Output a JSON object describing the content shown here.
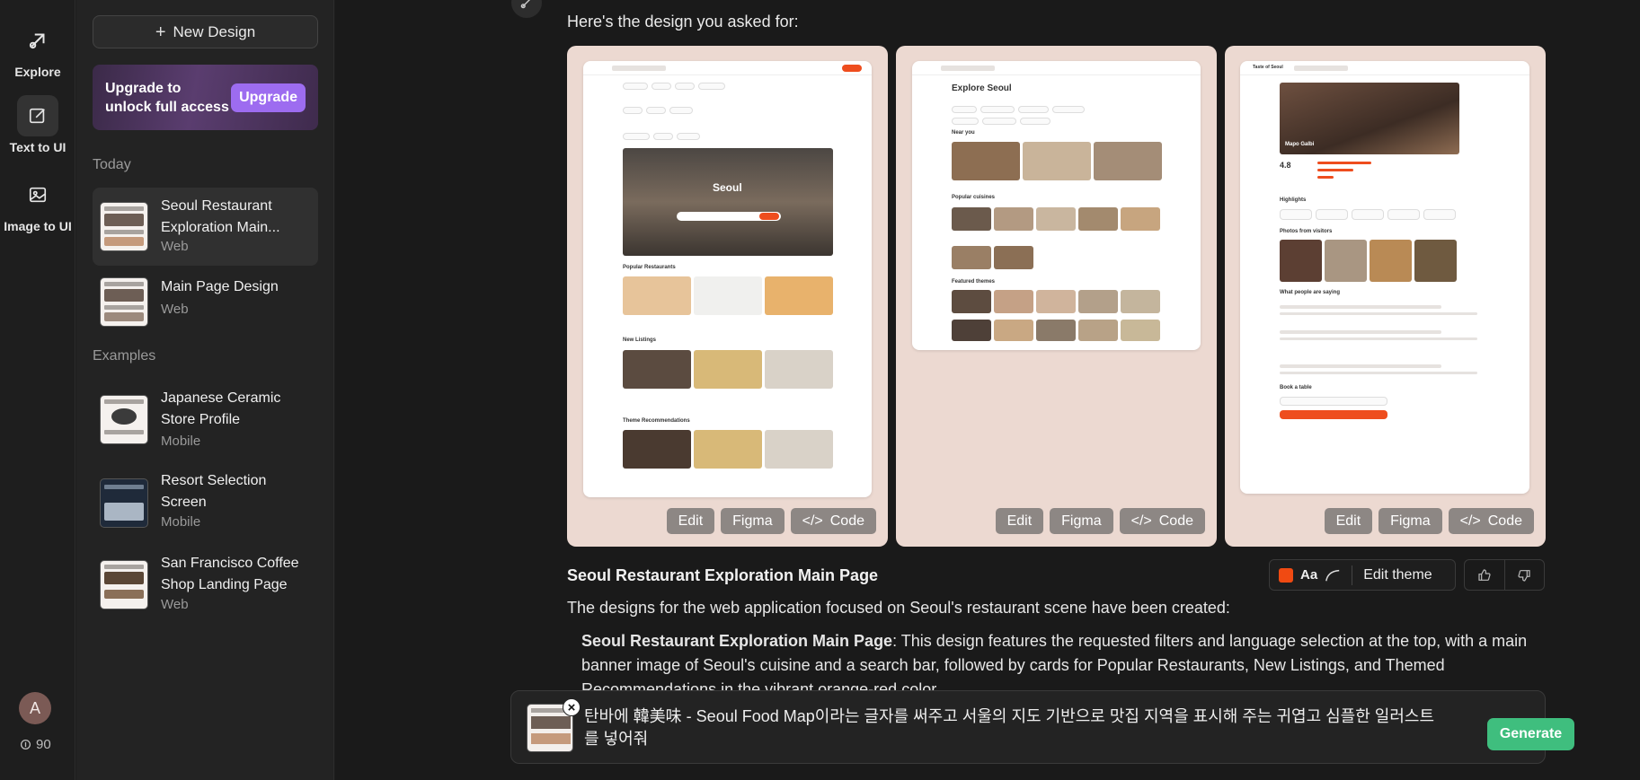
{
  "rail": {
    "explore": "Explore",
    "text_to_ui": "Text to UI",
    "image_to_ui": "Image to UI",
    "avatar_initial": "A",
    "credits": "90"
  },
  "sidebar": {
    "new_design": "New Design",
    "upgrade_text": "Upgrade to unlock full access",
    "upgrade_button": "Upgrade",
    "today_label": "Today",
    "examples_label": "Examples",
    "today": [
      {
        "title": "Seoul Restaurant Exploration Main...",
        "type": "Web"
      },
      {
        "title": "Main Page Design",
        "type": "Web"
      }
    ],
    "examples": [
      {
        "title": "Japanese Ceramic Store Profile",
        "type": "Mobile"
      },
      {
        "title": "Resort Selection Screen",
        "type": "Mobile"
      },
      {
        "title": "San Francisco Coffee Shop Landing Page",
        "type": "Web"
      }
    ]
  },
  "main": {
    "intro": "Here's the design you asked for:",
    "buttons": {
      "edit": "Edit",
      "figma": "Figma",
      "code": "Code"
    },
    "preview1": {
      "hero": "Seoul",
      "popular": "Popular Restaurants",
      "new": "New Listings",
      "theme_rec": "Theme Recommendations"
    },
    "preview2": {
      "title": "Explore Seoul",
      "near": "Near you",
      "cuisines": "Popular cuisines",
      "themes": "Featured themes"
    },
    "preview3": {
      "brand": "Taste of Seoul",
      "dish": "Mapo Galbi",
      "rating": "4.8",
      "highlights": "Highlights",
      "photos": "Photos from visitors",
      "reviews": "What people are saying",
      "book": "Book a table"
    },
    "project_title": "Seoul Restaurant Exploration Main Page",
    "theme": {
      "aa": "Aa",
      "edit_theme": "Edit theme",
      "accent": "#f04a12"
    },
    "description": "The designs for the web application focused on Seoul's restaurant scene have been created:",
    "bullet_bold": "Seoul Restaurant Exploration Main Page",
    "bullet_text": ": This design features the requested filters and language selection at the top, with a main banner image of Seoul's cuisine and a search bar, followed by cards for Popular Restaurants, New Listings, and Themed Recommendations in the vibrant orange-red color.",
    "prompt": "탄바에 韓美味 - Seoul Food Map이라는 글자를 써주고 서울의 지도 기반으로 맛집 지역을 표시해 주는 귀엽고 심플한 일러스트를 넣어줘",
    "generate": "Generate"
  }
}
